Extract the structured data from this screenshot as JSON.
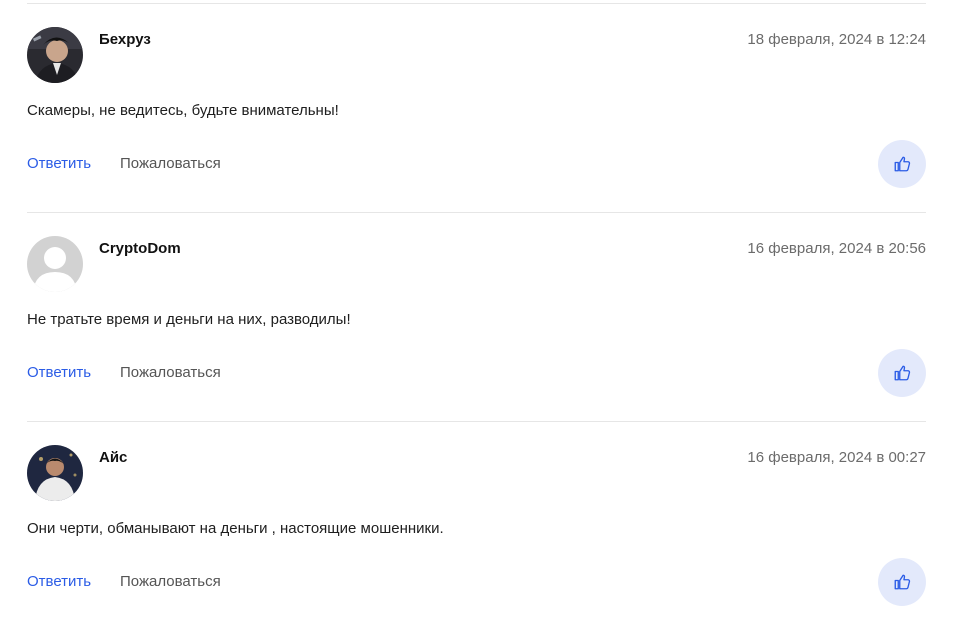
{
  "comments": [
    {
      "author": "Бехруз",
      "date": "18 февраля, 2024 в 12:24",
      "text": "Скамеры, не ведитесь, будьте внимательны!",
      "reply_label": "Ответить",
      "complain_label": "Пожаловаться",
      "avatar_icon": "user-photo-avatar"
    },
    {
      "author": "CryptoDom",
      "date": "16 февраля, 2024 в 20:56",
      "text": "Не тратьте время и деньги на них, разводилы!",
      "reply_label": "Ответить",
      "complain_label": "Пожаловаться",
      "avatar_icon": "default-user-avatar"
    },
    {
      "author": "Айс",
      "date": "16 февраля, 2024 в 00:27",
      "text": "Они черти, обманывают на деньги , настоящие мошенники.",
      "reply_label": "Ответить",
      "complain_label": "Пожаловаться",
      "avatar_icon": "user-photo-avatar"
    }
  ],
  "colors": {
    "link": "#2b5ce6",
    "like_bg": "#e3e9fb",
    "divider": "#e6e6e6"
  },
  "icons": {
    "like": "thumbs-up-icon"
  }
}
